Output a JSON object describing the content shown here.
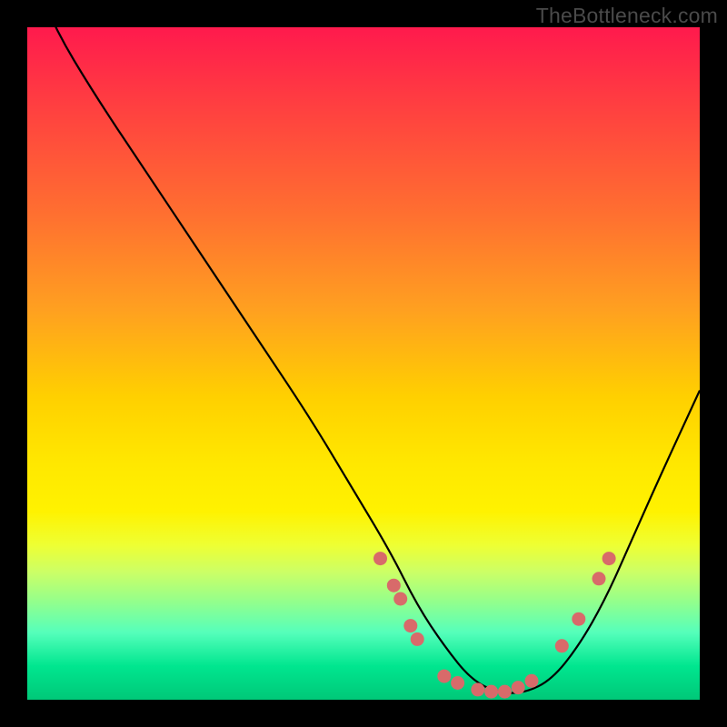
{
  "watermark": "TheBottleneck.com",
  "colors": {
    "background": "#000000",
    "curve_stroke": "#000000",
    "dot_fill": "#d86a6a",
    "dot_stroke": "#b84545"
  },
  "chart_data": {
    "type": "line",
    "title": "",
    "xlabel": "",
    "ylabel": "",
    "xlim": [
      0,
      100
    ],
    "ylim": [
      0,
      100
    ],
    "annotations": [
      "TheBottleneck.com"
    ],
    "series": [
      {
        "name": "bottleneck-curve",
        "x": [
          0,
          4,
          10,
          18,
          26,
          34,
          42,
          48,
          54,
          58,
          62,
          66,
          70,
          74,
          78,
          82,
          86,
          90,
          94,
          100
        ],
        "values": [
          110,
          100,
          90,
          78,
          66,
          54,
          42,
          32,
          22,
          14,
          8,
          3,
          1,
          1,
          3,
          8,
          15,
          24,
          33,
          46
        ]
      }
    ],
    "dots": [
      {
        "x": 52.5,
        "y": 21
      },
      {
        "x": 54.5,
        "y": 17
      },
      {
        "x": 55.5,
        "y": 15
      },
      {
        "x": 57,
        "y": 11
      },
      {
        "x": 58,
        "y": 9
      },
      {
        "x": 62,
        "y": 3.5
      },
      {
        "x": 64,
        "y": 2.5
      },
      {
        "x": 67,
        "y": 1.5
      },
      {
        "x": 69,
        "y": 1.2
      },
      {
        "x": 71,
        "y": 1.2
      },
      {
        "x": 73,
        "y": 1.8
      },
      {
        "x": 75,
        "y": 2.8
      },
      {
        "x": 79.5,
        "y": 8
      },
      {
        "x": 82,
        "y": 12
      },
      {
        "x": 85,
        "y": 18
      },
      {
        "x": 86.5,
        "y": 21
      }
    ]
  }
}
